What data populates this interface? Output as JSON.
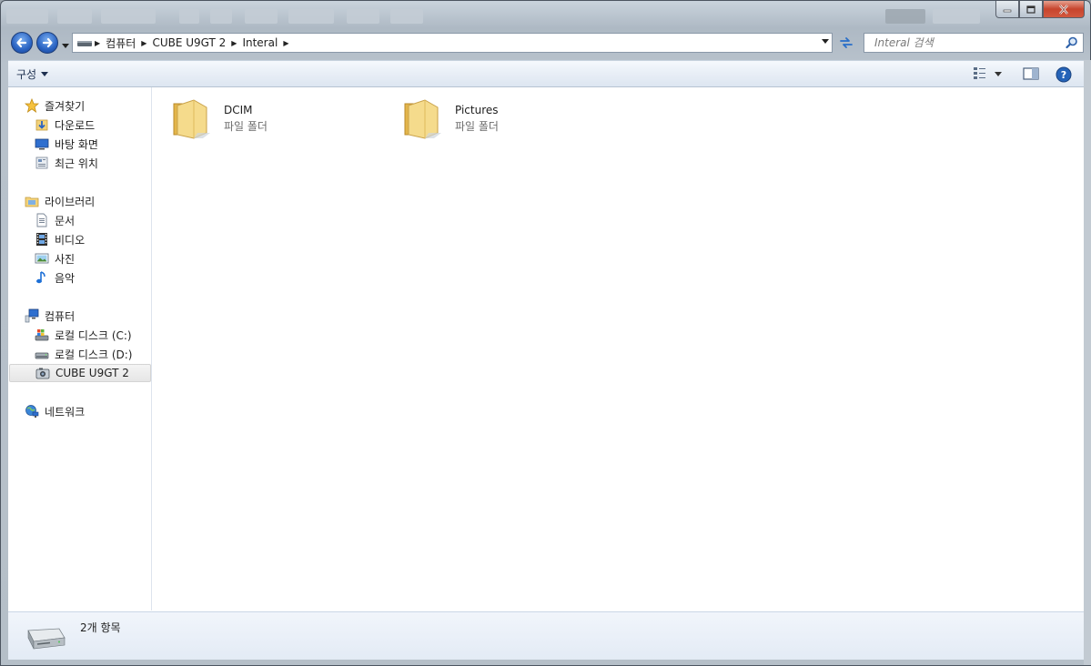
{
  "window": {
    "buttons": {
      "minimize": "minimize",
      "maximize": "maximize",
      "close": "close"
    }
  },
  "address": {
    "crumbs": [
      "컴퓨터",
      "CUBE U9GT 2",
      "Interal"
    ]
  },
  "search": {
    "placeholder": "Interal 검색"
  },
  "toolbar": {
    "organize_label": "구성"
  },
  "sidebar": {
    "favorites": {
      "label": "즐겨찾기",
      "items": [
        "다운로드",
        "바탕 화면",
        "최근 위치"
      ]
    },
    "libraries": {
      "label": "라이브러리",
      "items": [
        "문서",
        "비디오",
        "사진",
        "음악"
      ]
    },
    "computer": {
      "label": "컴퓨터",
      "items": [
        "로컬 디스크 (C:)",
        "로컬 디스크 (D:)",
        "CUBE U9GT 2"
      ],
      "selected": "CUBE U9GT 2"
    },
    "network": {
      "label": "네트워크"
    }
  },
  "files": [
    {
      "name": "DCIM",
      "type": "파일 폴더"
    },
    {
      "name": "Pictures",
      "type": "파일 폴더"
    }
  ],
  "status": {
    "count_text": "2개 항목"
  },
  "colors": {
    "accent": "#2a63c2",
    "folder": "#f2d27a",
    "selection": "#e6e6e6"
  }
}
